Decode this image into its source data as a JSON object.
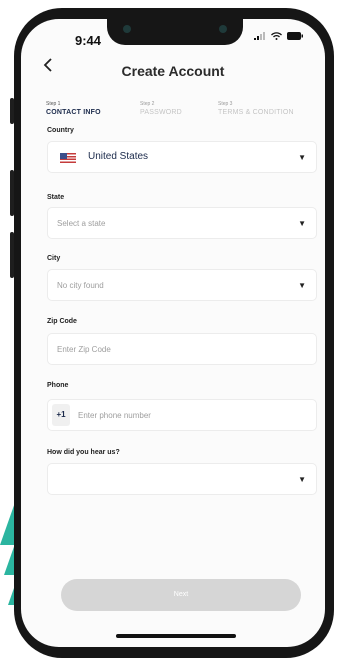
{
  "status_bar": {
    "time": "9:44"
  },
  "header": {
    "back_icon": "chevron-left-icon",
    "title": "Create Account"
  },
  "steps": [
    {
      "number": "Step 1",
      "label": "CONTACT INFO",
      "active": true
    },
    {
      "number": "Step 2",
      "label": "PASSWORD",
      "active": false
    },
    {
      "number": "Step 3",
      "label": "TERMS & CONDITION",
      "active": false
    }
  ],
  "form": {
    "country": {
      "label": "Country",
      "value": "United States",
      "flag": "us-flag-icon"
    },
    "state": {
      "label": "State",
      "placeholder": "Select a state"
    },
    "city": {
      "label": "City",
      "placeholder": "No city found"
    },
    "zip": {
      "label": "Zip Code",
      "placeholder": "Enter Zip Code"
    },
    "phone": {
      "label": "Phone",
      "prefix": "+1",
      "placeholder": "Enter phone number"
    },
    "referral": {
      "label": "How did you hear us?",
      "value": ""
    }
  },
  "next_button": {
    "label": "Next"
  },
  "colors": {
    "accent": "#1b2a4b",
    "decoration": "#2bb5a0",
    "button_disabled": "#d6d6d6"
  }
}
